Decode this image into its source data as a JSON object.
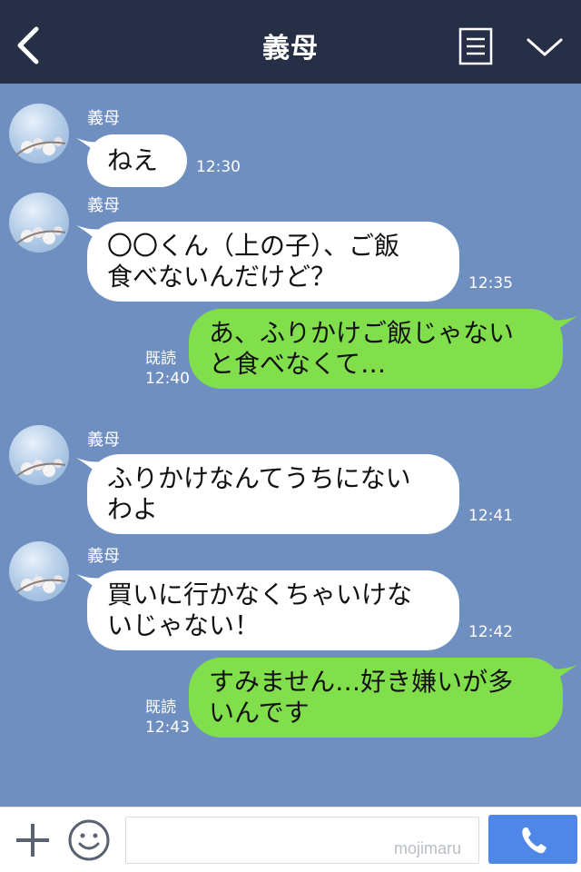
{
  "header": {
    "title": "義母",
    "back_icon": "chevron-left-icon",
    "menu_icon": "list-menu-icon",
    "collapse_icon": "chevron-down-icon"
  },
  "messages": [
    {
      "side": "in",
      "sender": "義母",
      "text": "ねえ",
      "time": "12:30"
    },
    {
      "side": "in",
      "sender": "義母",
      "text": "〇〇くん（上の子）、ご飯\n食べないんだけど？",
      "time": "12:35"
    },
    {
      "side": "out",
      "read": "既読",
      "text": "あ、ふりかけご飯じゃない\nと食べなくて…",
      "time": "12:40"
    },
    {
      "side": "in",
      "sender": "義母",
      "text": "ふりかけなんてうちにない\nわよ",
      "time": "12:41"
    },
    {
      "side": "in",
      "sender": "義母",
      "text": "買いに行かなくちゃいけな\nいじゃない！",
      "time": "12:42"
    },
    {
      "side": "out",
      "read": "既読",
      "text": "すみません…好き嫌いが多\nいんです",
      "time": "12:43"
    }
  ],
  "footer": {
    "plus_icon": "plus-icon",
    "emoji_icon": "smiley-icon",
    "input_value": "",
    "watermark": "mojimaru",
    "call_icon": "phone-icon"
  },
  "colors": {
    "header_bg": "#262f45",
    "chat_bg": "#6f8fc1",
    "incoming_bubble": "#ffffff",
    "outgoing_bubble": "#82df4c",
    "call_button": "#4f87e8"
  }
}
